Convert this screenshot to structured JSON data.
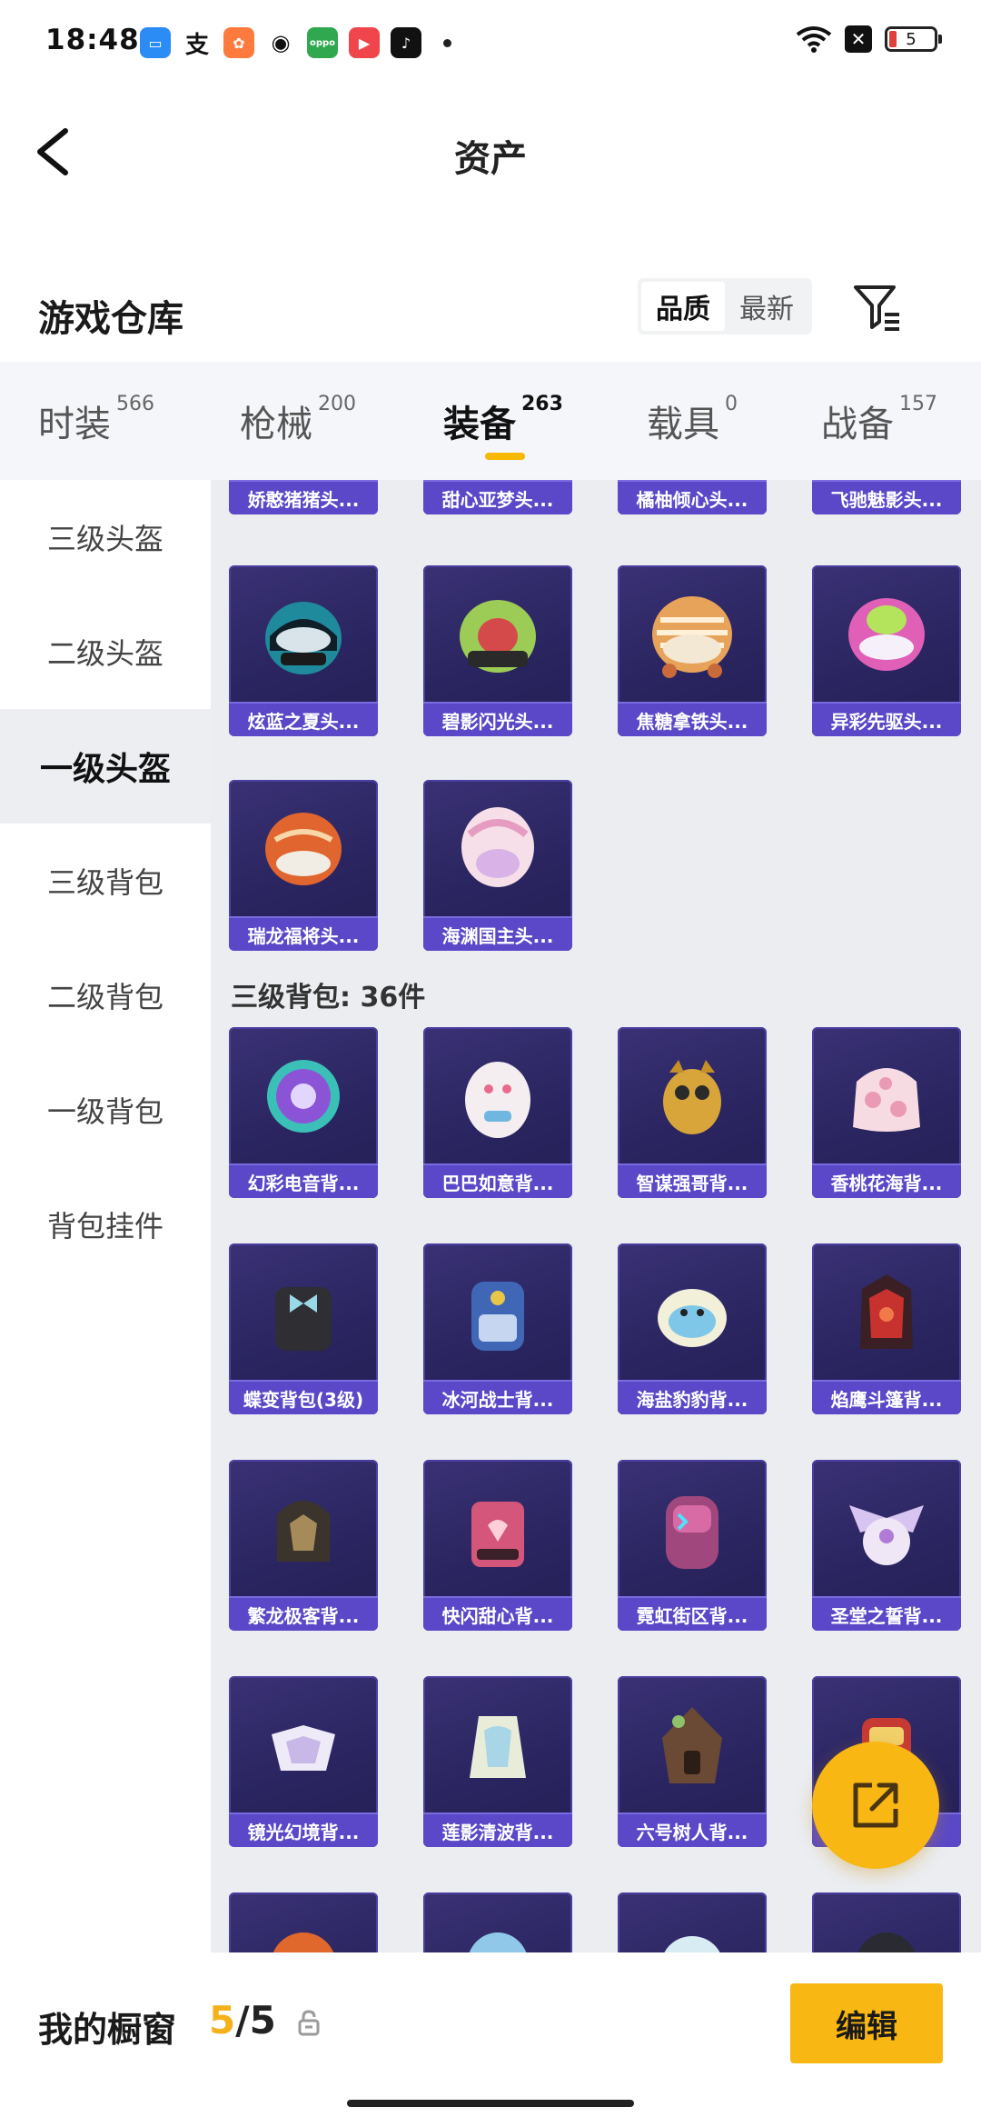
{
  "status": {
    "time": "18:48",
    "apps": [
      "files-app-icon",
      "alipay-icon",
      "photos-app-icon",
      "wechat-icon",
      "oppo-app-icon",
      "video-app-icon",
      "tiktok-icon"
    ],
    "box_label": "✕",
    "battery": "5"
  },
  "header": {
    "title": "资产"
  },
  "section": {
    "title": "游戏仓库",
    "sort_quality": "品质",
    "sort_latest": "最新"
  },
  "tabs": [
    {
      "label": "时装",
      "count": "566"
    },
    {
      "label": "枪械",
      "count": "200"
    },
    {
      "label": "装备",
      "count": "263"
    },
    {
      "label": "载具",
      "count": "0"
    },
    {
      "label": "战备",
      "count": "157"
    }
  ],
  "sidebar": [
    "三级头盔",
    "二级头盔",
    "一级头盔",
    "三级背包",
    "二级背包",
    "一级背包",
    "背包挂件"
  ],
  "grid": {
    "top_partial": [
      "娇憨猪猪头...",
      "甜心亚梦头...",
      "橘柚倾心头...",
      "飞驰魅影头..."
    ],
    "helmets_row1": [
      "炫蓝之夏头...",
      "碧影闪光头...",
      "焦糖拿铁头...",
      "异彩先驱头..."
    ],
    "helmets_row2": [
      "瑞龙福将头...",
      "海渊国主头..."
    ],
    "backpack_header": "三级背包: 36件",
    "backpacks_row1": [
      "幻彩电音背...",
      "巴巴如意背...",
      "智谋强哥背...",
      "香桃花海背..."
    ],
    "backpacks_row2": [
      "蝶变背包(3级)",
      "冰河战士背...",
      "海盐豹豹背...",
      "焰鹰斗篷背..."
    ],
    "backpacks_row3": [
      "繁龙极客背...",
      "快闪甜心背...",
      "霓虹街区背...",
      "圣堂之誓背..."
    ],
    "backpacks_row4": [
      "镜光幻境背...",
      "莲影清波背...",
      "六号树人背...",
      ""
    ]
  },
  "bottom": {
    "title": "我的橱窗",
    "current": "5",
    "total": "/5",
    "edit": "编辑"
  },
  "colors": {
    "accent": "#f8b712",
    "card_label": "#5a48c8",
    "card_bg": "#2a2560"
  }
}
